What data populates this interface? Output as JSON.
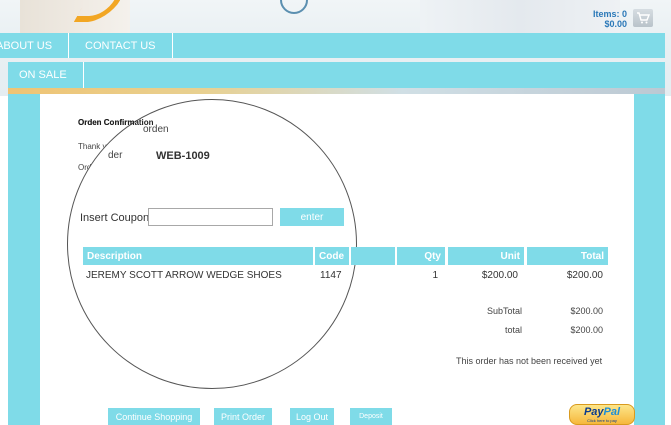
{
  "cart": {
    "items_label": "Items: 0",
    "amount": "$0.00"
  },
  "nav": {
    "primary": [
      "ABOUT US",
      "CONTACT US"
    ],
    "secondary": [
      "ON SALE"
    ]
  },
  "order": {
    "title": "Orden Confirmation",
    "thanks_fragment": "Thank you",
    "order_label_fragment": "Orde",
    "magnified_orden": "orden",
    "magnified_order_label": "der",
    "order_number": "WEB-1009"
  },
  "coupon": {
    "label": "Insert Coupon",
    "value": "",
    "button": "enter"
  },
  "table": {
    "headers": {
      "description": "Description",
      "code": "Code",
      "qty": "Qty",
      "unit": "Unit",
      "total": "Total"
    },
    "rows": [
      {
        "description": "JEREMY SCOTT ARROW WEDGE SHOES",
        "code": "1147",
        "qty": "1",
        "unit": "$200.00",
        "total": "$200.00"
      }
    ]
  },
  "summary": {
    "subtotal_label": "SubTotal",
    "subtotal_value": "$200.00",
    "total_label": "total",
    "total_value": "$200.00"
  },
  "status_text": "This order has not been received yet",
  "buttons": {
    "continue": "Continue Shopping",
    "print": "Print Order",
    "logout": "Log Out",
    "deposit": "Deposit"
  },
  "paypal": {
    "word_a": "Pay",
    "word_b": "Pal",
    "sub": "Click here to pay"
  },
  "colors": {
    "accent": "#7fdbe8",
    "link": "#2a78b8",
    "paypal_gold": "#f6b73c"
  }
}
